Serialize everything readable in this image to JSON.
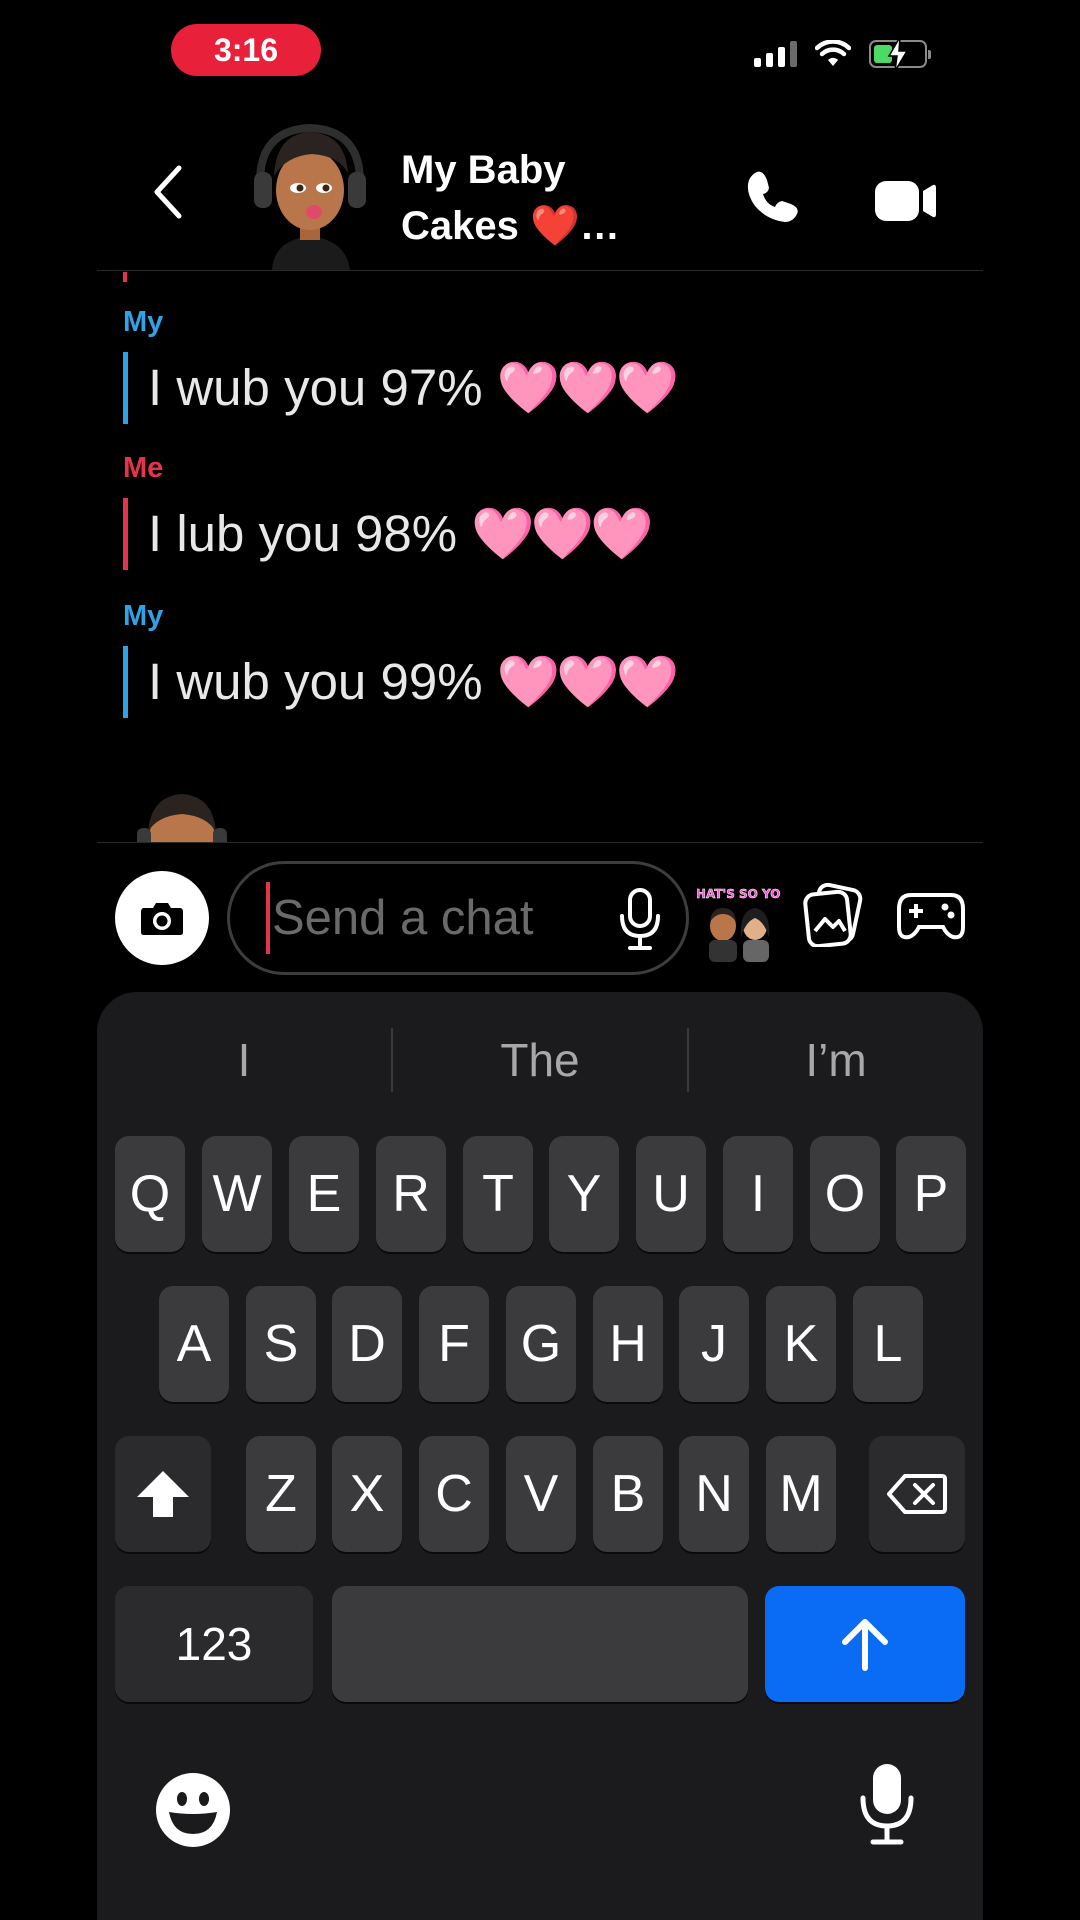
{
  "status_bar": {
    "time": "3:16"
  },
  "header": {
    "contact_name": "My Baby Cakes ❤️…"
  },
  "messages": [
    {
      "sender": "My",
      "text": "I wub you 97%",
      "emoji": "🩷🩷🩷",
      "color": "#2fa3e6"
    },
    {
      "sender": "Me",
      "text": "I lub you 98%",
      "emoji": "🩷🩷🩷",
      "color": "#e5334e"
    },
    {
      "sender": "My",
      "text": "I wub you 99%",
      "emoji": "🩷🩷🩷",
      "color": "#2fa3e6"
    }
  ],
  "chat_input": {
    "placeholder": "Send a chat",
    "value": ""
  },
  "sticker_caption": "THAT'S SO YOU",
  "keyboard": {
    "suggestions": [
      "I",
      "The",
      "I’m"
    ],
    "row1": [
      "Q",
      "W",
      "E",
      "R",
      "T",
      "Y",
      "U",
      "I",
      "O",
      "P"
    ],
    "row2": [
      "A",
      "S",
      "D",
      "F",
      "G",
      "H",
      "J",
      "K",
      "L"
    ],
    "row3": [
      "Z",
      "X",
      "C",
      "V",
      "B",
      "N",
      "M"
    ],
    "numbers_label": "123"
  },
  "icons": {
    "back": "chevron-left-icon",
    "call": "phone-icon",
    "video": "video-camera-icon",
    "camera": "camera-icon",
    "mic": "microphone-icon",
    "memories": "memories-icon",
    "games": "gamepad-icon",
    "shift": "shift-arrow-icon",
    "delete": "backspace-icon",
    "send": "send-arrow-icon",
    "emoji": "emoji-smile-icon"
  },
  "colors": {
    "status_pill": "#e8203a",
    "friend_accent": "#2fa3e6",
    "me_accent": "#e5334e",
    "send_key": "#0a6cf5"
  }
}
